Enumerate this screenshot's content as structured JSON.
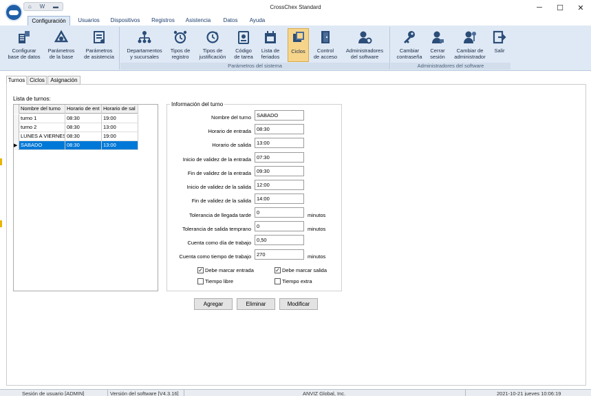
{
  "window": {
    "title": "CrossChex Standard",
    "minimize": "─",
    "maximize": "☐",
    "close": "✕"
  },
  "quick_access": [
    "⌂",
    "W",
    "▬"
  ],
  "ribbon_tabs": [
    "Configuración",
    "Usuarios",
    "Dispositivos",
    "Registros",
    "Asistencia",
    "Datos",
    "Ayuda"
  ],
  "ribbon": {
    "config_buttons": [
      "Configurar\nbase de datos",
      "Parámetros\nde la base",
      "Parámetros\nde asistencia"
    ],
    "system_buttons": [
      "Departamentos\ny sucursales",
      "Tipos de\nregistro",
      "Tipos de\njustificación",
      "Código\nde tarea",
      "Lista de\nferiados",
      "Ciclos",
      "Control\nde acceso",
      "Administradores\ndel software"
    ],
    "system_group_label": "Parámetros del sistema",
    "admin_buttons": [
      "Cambiar\ncontraseña",
      "Cerrar\nsesión",
      "Cambiar de\nadministrador",
      "Salir"
    ],
    "admin_group_label": "Administradores del software"
  },
  "content_tabs": [
    "Turnos",
    "Ciclos",
    "Asignación"
  ],
  "shift_list": {
    "label": "Lista de turnos:",
    "columns": [
      "Nombre del turno",
      "Horario de ent",
      "Horario de sal"
    ],
    "rows": [
      [
        "turno 1",
        "08:30",
        "19:00"
      ],
      [
        "turno 2",
        "08:30",
        "13:00"
      ],
      [
        "LUNES A VIERNES",
        "08:30",
        "19:00"
      ],
      [
        "SABADO",
        "08:30",
        "13:00"
      ]
    ],
    "selected_row": 3,
    "row_marker": "▶"
  },
  "shift_info": {
    "legend": "Información del turno",
    "fields": [
      {
        "label": "Nombre del turno",
        "value": "SABADO"
      },
      {
        "label": "Horario de entrada",
        "value": "08:30"
      },
      {
        "label": "Horario de salida",
        "value": "13:00"
      },
      {
        "label": "Inicio de validez de la entrada",
        "value": "07:30"
      },
      {
        "label": "Fin de validez de la entrada",
        "value": "09:30"
      },
      {
        "label": "Inicio de validez de la salida",
        "value": "12:00"
      },
      {
        "label": "Fin de validez de la salida",
        "value": "14:00"
      },
      {
        "label": "Tolerancia de llegada tarde",
        "value": "0",
        "unit": "minutos"
      },
      {
        "label": "Tolerancia de salida temprano",
        "value": "0",
        "unit": "minutos"
      },
      {
        "label": "Cuenta como día de trabajo",
        "value": "0,50"
      },
      {
        "label": "Cuenta como tiempo de trabajo",
        "value": "270",
        "unit": "minutos"
      }
    ],
    "checkboxes": [
      {
        "label": "Debe marcar entrada",
        "checked": true
      },
      {
        "label": "Debe marcar salida",
        "checked": true
      },
      {
        "label": "Tiempo libre",
        "checked": false
      },
      {
        "label": "Tiempo extra",
        "checked": false
      }
    ]
  },
  "actions": [
    "Agregar",
    "Eliminar",
    "Modificar"
  ],
  "status": {
    "session": "Sesión de usuario  [ADMIN]",
    "version": "Versión del software  [V4.3.16]",
    "company": "ANVIZ Global, Inc.",
    "datetime": "2021-10-21 jueves 10:06:19"
  },
  "colors": {
    "accent": "#0078d7",
    "ribbon_bg": "#dfe9f5",
    "active_button": "#f6d58b",
    "icon_blue": "#2b4d78"
  }
}
